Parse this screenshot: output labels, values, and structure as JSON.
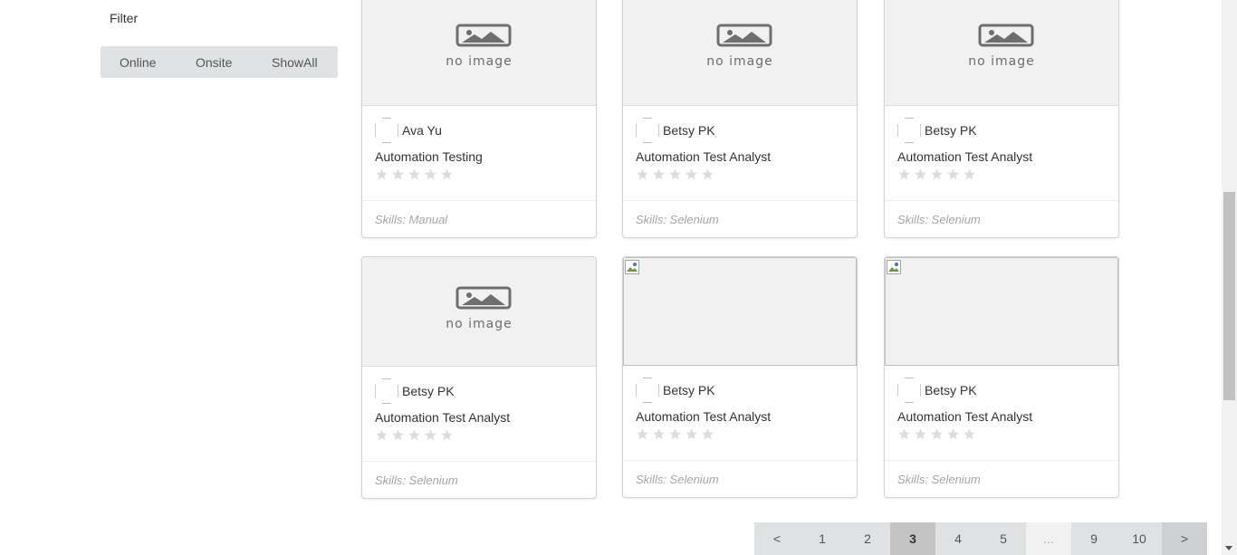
{
  "sidebar": {
    "filter_title": "Filter",
    "filter_buttons": [
      "Online",
      "Onsite",
      "ShowAll"
    ]
  },
  "cards": [
    {
      "author": "Ava Yu",
      "title": "Automation Testing",
      "skills": "Skills: Manual",
      "image": "no-image",
      "rating": 0
    },
    {
      "author": "Betsy PK",
      "title": "Automation Test Analyst",
      "skills": "Skills: Selenium",
      "image": "no-image",
      "rating": 0
    },
    {
      "author": "Betsy PK",
      "title": "Automation Test Analyst",
      "skills": "Skills: Selenium",
      "image": "no-image",
      "rating": 0
    },
    {
      "author": "Betsy PK",
      "title": "Automation Test Analyst",
      "skills": "Skills: Selenium",
      "image": "no-image",
      "rating": 0
    },
    {
      "author": "Betsy PK",
      "title": "Automation Test Analyst",
      "skills": "Skills: Selenium",
      "image": "broken-image",
      "rating": 0
    },
    {
      "author": "Betsy PK",
      "title": "Automation Test Analyst",
      "skills": "Skills: Selenium",
      "image": "broken-image",
      "rating": 0
    }
  ],
  "no_image_text": "no image",
  "pagination": {
    "prev": "<",
    "pages": [
      "1",
      "2",
      "3",
      "4",
      "5",
      "...",
      "9",
      "10"
    ],
    "active": "3",
    "next": ">"
  },
  "colors": {
    "filter_bg": "#e0e1e2",
    "image_bg": "#f1f1f1",
    "star_empty": "#dcdcdc",
    "skills_text": "#a5a5a5"
  }
}
